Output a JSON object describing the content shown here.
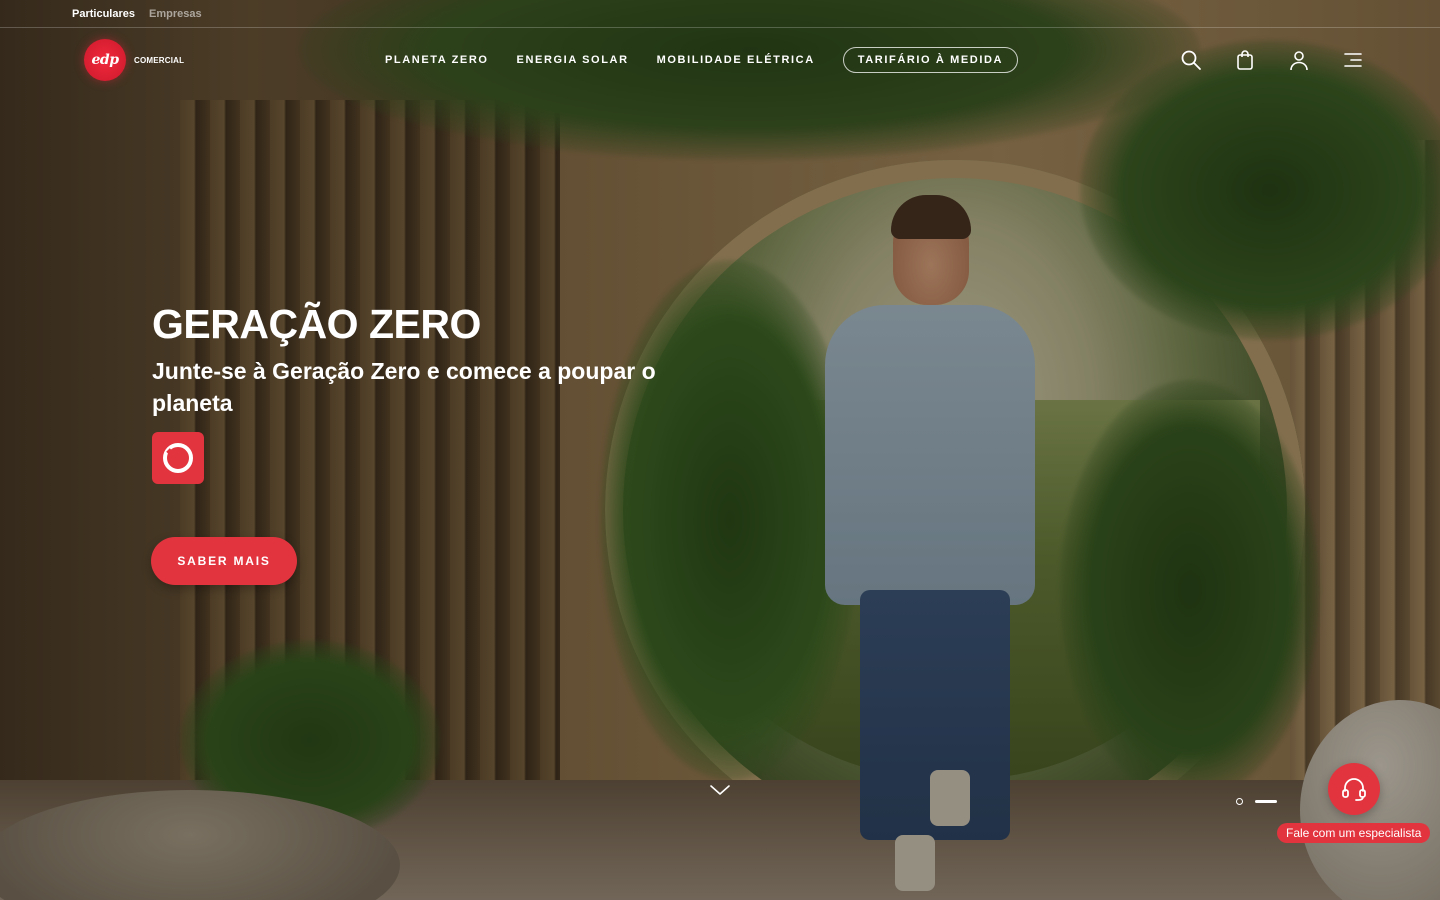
{
  "segments": {
    "particulares": "Particulares",
    "empresas": "Empresas"
  },
  "logo": {
    "mark": "edp",
    "subtitle": "COMERCIAL"
  },
  "nav": {
    "items": [
      {
        "label": "PLANETA ZERO"
      },
      {
        "label": "ENERGIA SOLAR"
      },
      {
        "label": "MOBILIDADE ELÉTRICA"
      },
      {
        "label": "TARIFÁRIO À MEDIDA"
      }
    ]
  },
  "header_icons": [
    "search-icon",
    "shopping-bag-icon",
    "user-icon",
    "menu-icon"
  ],
  "hero": {
    "title": "GERAÇÃO ZERO",
    "subtitle": "Junte-se à Geração Zero e comece a poupar o planeta",
    "cta": "SABER MAIS"
  },
  "carousel": {
    "slides": 2,
    "active": 2
  },
  "expert": {
    "label": "Fale com um especialista"
  },
  "colors": {
    "brand_red": "#e2343f",
    "text": "#ffffff"
  }
}
